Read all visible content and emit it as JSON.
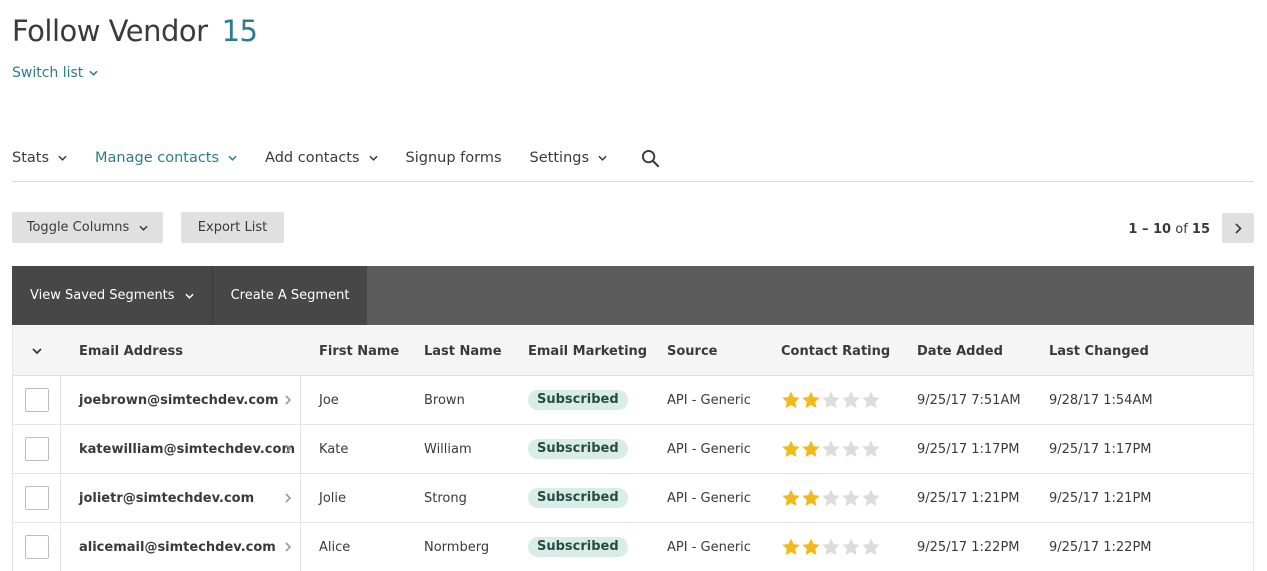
{
  "page": {
    "title": "Follow Vendor",
    "count": "15",
    "switch_list": "Switch list"
  },
  "tabs": [
    {
      "label": "Stats",
      "has_dropdown": true,
      "active": false
    },
    {
      "label": "Manage contacts",
      "has_dropdown": true,
      "active": true
    },
    {
      "label": "Add contacts",
      "has_dropdown": true,
      "active": false
    },
    {
      "label": "Signup forms",
      "has_dropdown": false,
      "active": false
    },
    {
      "label": "Settings",
      "has_dropdown": true,
      "active": false
    }
  ],
  "search_icon": "search-icon",
  "toolbar": {
    "toggle_columns": "Toggle Columns",
    "export_list": "Export List",
    "pager_range": "1 – 10",
    "pager_of": "of",
    "pager_total": "15"
  },
  "segments": {
    "view_saved": "View Saved Segments",
    "create": "Create A Segment"
  },
  "table": {
    "headers": {
      "email": "Email Address",
      "first": "First Name",
      "last": "Last Name",
      "email_marketing": "Email Marketing",
      "source": "Source",
      "rating": "Contact Rating",
      "added": "Date Added",
      "changed": "Last Changed"
    },
    "rows": [
      {
        "email": "joebrown@simtechdev.com",
        "first": "Joe",
        "last": "Brown",
        "status": "Subscribed",
        "source": "API - Generic",
        "rating": 2,
        "added": "9/25/17 7:51AM",
        "changed": "9/28/17 1:54AM"
      },
      {
        "email": "katewilliam@simtechdev.com",
        "first": "Kate",
        "last": "William",
        "status": "Subscribed",
        "source": "API - Generic",
        "rating": 2,
        "added": "9/25/17 1:17PM",
        "changed": "9/25/17 1:17PM"
      },
      {
        "email": "jolietr@simtechdev.com",
        "first": "Jolie",
        "last": "Strong",
        "status": "Subscribed",
        "source": "API - Generic",
        "rating": 2,
        "added": "9/25/17 1:21PM",
        "changed": "9/25/17 1:21PM"
      },
      {
        "email": "alicemail@simtechdev.com",
        "first": "Alice",
        "last": "Normberg",
        "status": "Subscribed",
        "source": "API - Generic",
        "rating": 2,
        "added": "9/25/17 1:22PM",
        "changed": "9/25/17 1:22PM"
      }
    ]
  },
  "colors": {
    "accent": "#2d7c8c",
    "star_filled": "#f2b91c",
    "star_empty": "#dcdcdc",
    "badge_bg": "#d7ede6"
  }
}
